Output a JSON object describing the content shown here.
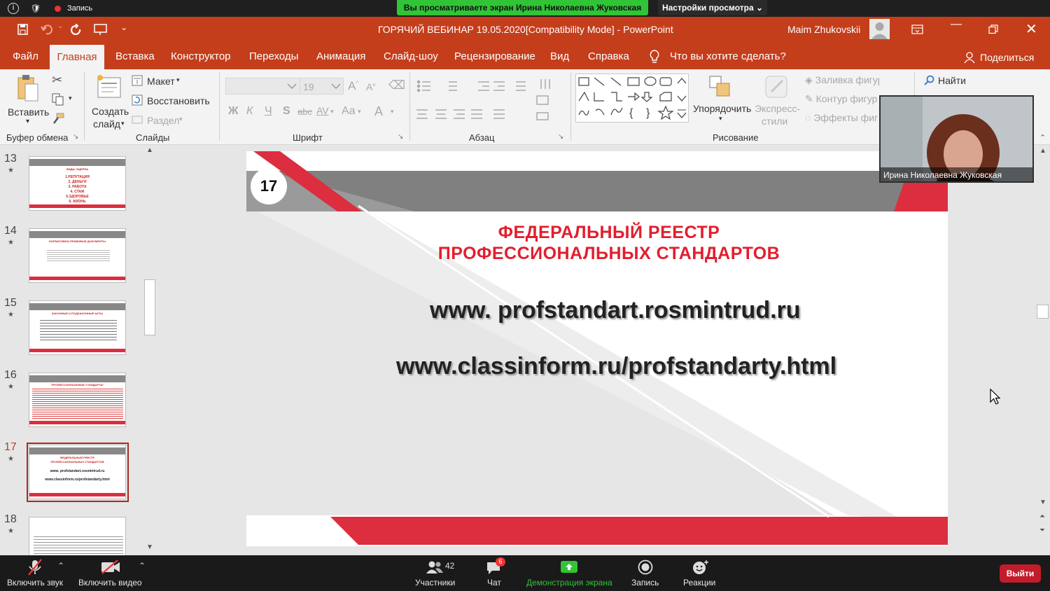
{
  "zoom_top": {
    "recording_label": "Запись",
    "share_banner": "Вы просматриваете экран Ирина Николаевна Жуковская",
    "view_settings": "Настройки просмотра"
  },
  "titlebar": {
    "title": "ГОРЯЧИЙ ВЕБИНАР 19.05.2020[Compatibility Mode]  -  PowerPoint",
    "user": "Maim Zhukovskii"
  },
  "tabs": [
    "Файл",
    "Главная",
    "Вставка",
    "Конструктор",
    "Переходы",
    "Анимация",
    "Слайд-шоу",
    "Рецензирование",
    "Вид",
    "Справка"
  ],
  "tell_me": "Что вы хотите сделать?",
  "share_button": "Поделиться",
  "ribbon": {
    "paste": "Вставить",
    "clipboard_group": "Буфер обмена",
    "new_slide_1": "Создать",
    "new_slide_2": "слайд",
    "layout": "Макет",
    "reset": "Восстановить",
    "section": "Раздел",
    "slides_group": "Слайды",
    "font_size": "19",
    "bold": "Ж",
    "italic": "К",
    "underline": "Ч",
    "shadow": "S",
    "strike": "abc",
    "spacing": "AV",
    "case": "Aa",
    "font_color": "A",
    "font_group": "Шрифт",
    "paragraph_group": "Абзац",
    "arrange": "Упорядочить",
    "quick_styles_1": "Экспресс-",
    "quick_styles_2": "стили",
    "fill": "Заливка фигуры",
    "outline": "Контур фигур",
    "effects": "Эффекты фиг",
    "drawing_group": "Рисование",
    "find": "Найти"
  },
  "thumbnails": [
    {
      "num": "13",
      "lines": [
        "ВИДЫ УЩЕРБА",
        "1.РЕПУТАЦИЯ",
        "2. ДЕНЬГИ",
        "3. РАБОТА",
        "4. СТАЖ",
        "5.ЗДОРОВЬЕ",
        "6. ЖИЗНЬ"
      ]
    },
    {
      "num": "14",
      "lines": [
        "НОРМАТИВНО-ПРАВОВЫЕ ДОКУМЕНТЫ"
      ]
    },
    {
      "num": "15",
      "lines": [
        "ЗАКОННЫЕ И ПОДЗАКОННЫЕ АКТЫ"
      ]
    },
    {
      "num": "16",
      "lines": [
        "ПРОФЕССИОНАЛЬНЫЕ СТАНДАРТЫ"
      ]
    },
    {
      "num": "17",
      "lines": [
        "ФЕДЕРАЛЬНЫЙ РЕЕСТР",
        "ПРОФЕССИОНАЛЬНЫХ СТАНДАРТОВ",
        "www. profstandart.rosmintrud.ru",
        "www.classinform.ru/profstandarty.html"
      ]
    },
    {
      "num": "18",
      "lines": []
    }
  ],
  "slide": {
    "number": "17",
    "title_line1": "ФЕДЕРАЛЬНЫЙ РЕЕСТР",
    "title_line2": "ПРОФЕССИОНАЛЬНЫХ СТАНДАРТОВ",
    "link1": "www. profstandart.rosmintrud.ru",
    "link2": "www.classinform.ru/profstandarty.html"
  },
  "webcam_name": "Ирина Николаевна Жуковская",
  "bottom": {
    "mute": "Включить звук",
    "video": "Включить видео",
    "participants": "Участники",
    "participants_count": "42",
    "chat": "Чат",
    "chat_badge": "6",
    "share": "Демонстрация экрана",
    "record": "Запись",
    "reactions": "Реакции",
    "leave": "Выйти"
  },
  "colors": {
    "accent": "#c43e1c",
    "slide_red": "#dc2e3e",
    "zoom_green": "#31c437",
    "leave_red": "#c21c2b"
  }
}
